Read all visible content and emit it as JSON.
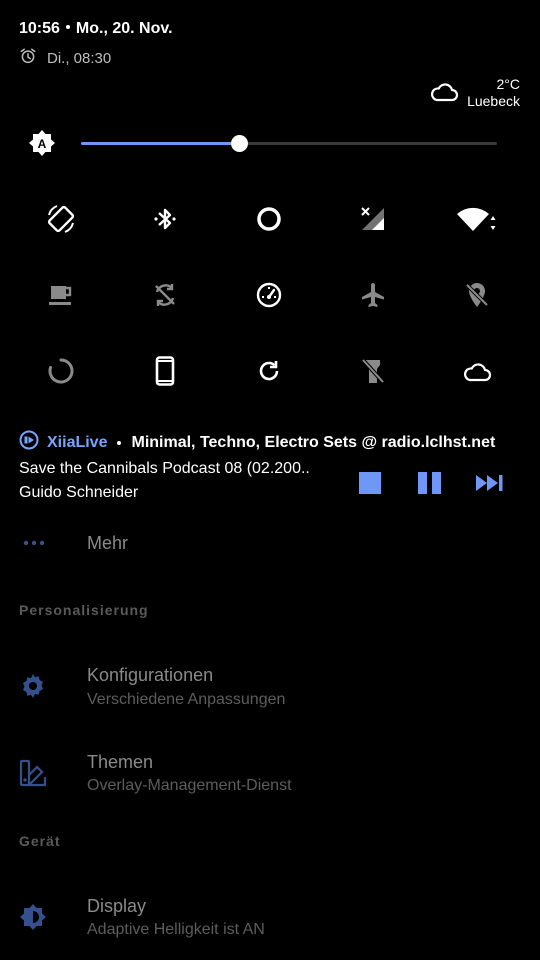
{
  "header": {
    "time": "10:56",
    "date": "Mo., 20. Nov.",
    "alarm": "Di., 08:30"
  },
  "weather": {
    "temp": "2°C",
    "location": "Luebeck",
    "icon": "cloud-icon"
  },
  "brightness": {
    "level": 0.38,
    "mode_icon": "auto-brightness-icon",
    "accent": "#6f97f5"
  },
  "quick_tiles": [
    {
      "name": "auto-rotate",
      "icon": "rotate-screen-icon",
      "active": true
    },
    {
      "name": "bluetooth",
      "icon": "bluetooth-icon",
      "active": true
    },
    {
      "name": "do-not-disturb",
      "icon": "circle-icon",
      "active": true
    },
    {
      "name": "mobile-data",
      "icon": "signal-off-icon",
      "active": true
    },
    {
      "name": "wifi",
      "icon": "wifi-icon",
      "active": true
    },
    {
      "name": "caffeine",
      "icon": "coffee-cup-icon",
      "active": false
    },
    {
      "name": "sync",
      "icon": "sync-off-icon",
      "active": false
    },
    {
      "name": "performance",
      "icon": "gauge-icon",
      "active": true
    },
    {
      "name": "airplane-mode",
      "icon": "airplane-icon",
      "active": false
    },
    {
      "name": "location",
      "icon": "location-off-icon",
      "active": false
    },
    {
      "name": "loading",
      "icon": "spinner-icon",
      "active": false
    },
    {
      "name": "device",
      "icon": "phone-icon",
      "active": true
    },
    {
      "name": "refresh",
      "icon": "refresh-icon",
      "active": true
    },
    {
      "name": "flashlight",
      "icon": "flashlight-off-icon",
      "active": false
    },
    {
      "name": "cloud",
      "icon": "cloud-icon",
      "active": true
    }
  ],
  "media": {
    "app": "XiiaLive",
    "station": "Minimal, Techno, Electro Sets @ radio.lclhst.net",
    "title": "Save the Cannibals Podcast 08 (02.200..",
    "artist": "Guido Schneider",
    "accent": "#6f97f5"
  },
  "settings": {
    "more_label": "Mehr",
    "section_personal": "Personalisierung",
    "config_title": "Konfigurationen",
    "config_sub": "Verschiedene Anpassungen",
    "themes_title": "Themen",
    "themes_sub": "Overlay-Management-Dienst",
    "section_device": "Gerät",
    "display_title": "Display",
    "display_sub": "Adaptive Helligkeit ist AN"
  }
}
